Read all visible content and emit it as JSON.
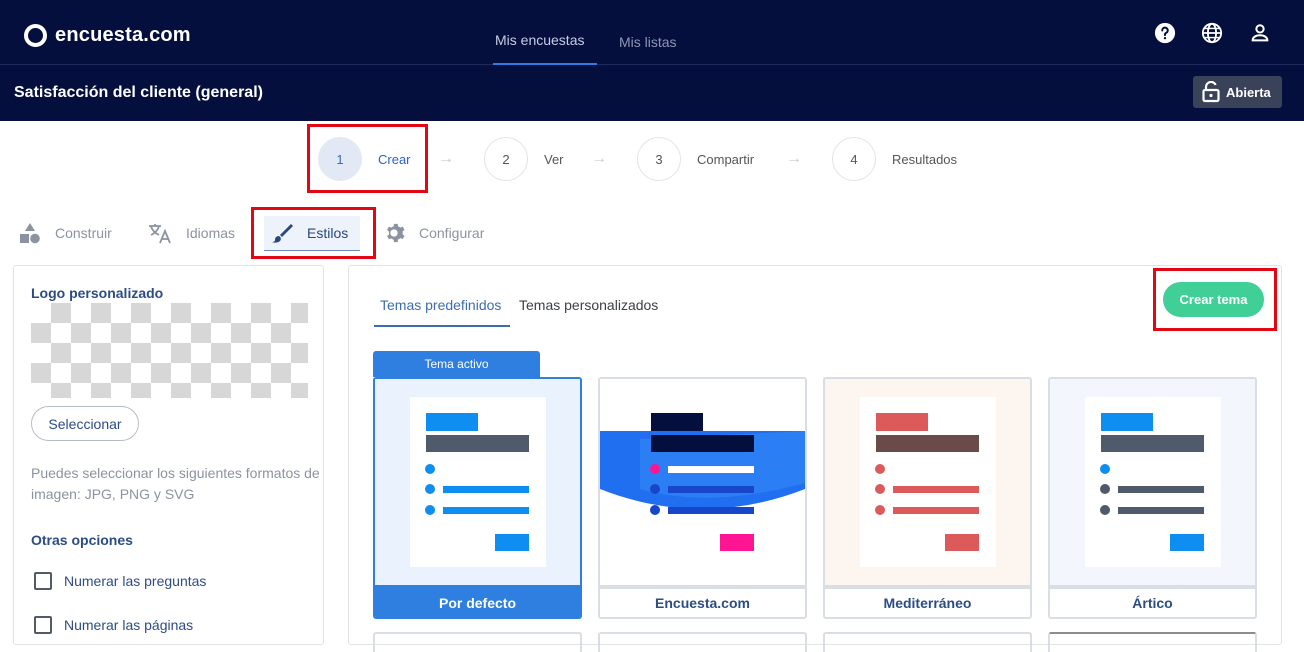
{
  "header": {
    "brand": "encuesta.com",
    "nav": [
      {
        "label": "Mis encuestas"
      },
      {
        "label": "Mis listas"
      }
    ],
    "icons": [
      "help-icon",
      "globe-icon",
      "user-icon"
    ]
  },
  "subheader": {
    "survey_title": "Satisfacción del cliente (general)",
    "status_label": "Abierta"
  },
  "steps": [
    {
      "number": "1",
      "label": "Crear"
    },
    {
      "number": "2",
      "label": "Ver"
    },
    {
      "number": "3",
      "label": "Compartir"
    },
    {
      "number": "4",
      "label": "Resultados"
    }
  ],
  "subtabs": [
    {
      "label": "Construir",
      "icon": "shapes-icon"
    },
    {
      "label": "Idiomas",
      "icon": "translate-icon"
    },
    {
      "label": "Estilos",
      "icon": "brush-icon"
    },
    {
      "label": "Configurar",
      "icon": "gear-icon"
    }
  ],
  "left_panel": {
    "logo_heading": "Logo personalizado",
    "select_button": "Seleccionar",
    "hint": "Puedes seleccionar los siguientes formatos de imagen: JPG, PNG y SVG",
    "options_heading": "Otras opciones",
    "options": [
      {
        "label": "Numerar las preguntas"
      },
      {
        "label": "Numerar las páginas"
      }
    ]
  },
  "themes": {
    "tabs": [
      {
        "label": "Temas predefinidos"
      },
      {
        "label": "Temas personalizados"
      }
    ],
    "create_button": "Crear tema",
    "active_tag": "Tema activo",
    "cards": [
      {
        "name": "Por defecto",
        "bg": "#eaf3fd",
        "accent": "#0d8ef0",
        "bar": "#4f5b6a",
        "dot": "#0d8ef0",
        "line": "#0d8ef0",
        "btn": "#0d8ef0"
      },
      {
        "name": "Encuesta.com",
        "bg": "#ffffff",
        "accent": "#050f3e",
        "bar": "#050f3e",
        "dot": "#ff1493",
        "line": "#ffffff",
        "btn": "#ff1493"
      },
      {
        "name": "Mediterráneo",
        "bg": "#fdf5f0",
        "accent": "#dd5a5a",
        "bar": "#6b4a4a",
        "dot": "#dd5a5a",
        "line": "#dd5a5a",
        "btn": "#dd5a5a"
      },
      {
        "name": "Ártico",
        "bg": "#f3f6fd",
        "accent": "#0d8ef0",
        "bar": "#4f5b6a",
        "dot": "#0d8ef0",
        "line": "#4f5b6a",
        "btn": "#0d8ef0"
      }
    ]
  }
}
